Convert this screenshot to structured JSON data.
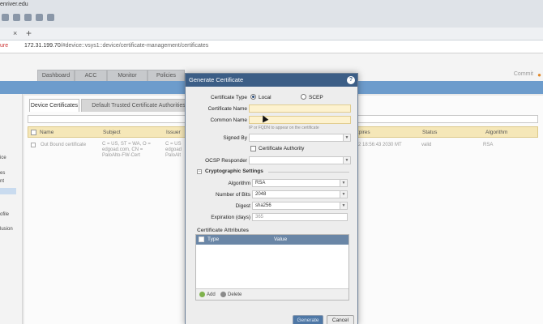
{
  "browser": {
    "window_title": "enriver.edu",
    "tab_close": "×",
    "tab_new": "+",
    "url_warning": "ure",
    "url_host": "172.31.199.70",
    "url_path": "/#device::vsys1::device/certificate-management/certificates"
  },
  "app_nav": {
    "tabs": [
      "Dashboard",
      "ACC",
      "Monitor",
      "Policies"
    ],
    "commit_label": "Commit",
    "accent": "#6d9ccc"
  },
  "sidebar": {
    "items": [
      "ice",
      "es",
      "nt",
      "ofile",
      "lusion"
    ]
  },
  "content": {
    "subtabs": [
      "Device Certificates",
      "Default Trusted Certificate Authorities"
    ],
    "grid_columns": [
      "Name",
      "Subject",
      "Issuer",
      "Expires",
      "Status",
      "Algorithm"
    ],
    "row": {
      "name": "Out Bound certificate",
      "subject": "C = US, ST = WA, O = edgoad.com, CN = PaloAlto-FW-Cert",
      "issuer": "C = US edgoad PaloAlt",
      "expires": "v 12 18:56:43 2030 MT",
      "status": "valid",
      "algorithm": "RSA"
    }
  },
  "dialog": {
    "title": "Generate Certificate",
    "help": "?",
    "certificate_type": {
      "label": "Certificate Type",
      "option_local": "Local",
      "option_scep": "SCEP"
    },
    "certificate_name": {
      "label": "Certificate Name",
      "value": ""
    },
    "common_name": {
      "label": "Common Name",
      "value": "",
      "hint": "IP or FQDN to appear on the certificate"
    },
    "signed_by": {
      "label": "Signed By",
      "value": ""
    },
    "certificate_authority": {
      "label": "Certificate Authority"
    },
    "ocsp_responder": {
      "label": "OCSP Responder",
      "value": ""
    },
    "crypto": {
      "title": "Cryptographic Settings",
      "collapse": "−",
      "algorithm": {
        "label": "Algorithm",
        "value": "RSA"
      },
      "bits": {
        "label": "Number of Bits",
        "value": "2048"
      },
      "digest": {
        "label": "Digest",
        "value": "sha256"
      },
      "expiration": {
        "label": "Expiration (days)",
        "value": "365"
      }
    },
    "attributes": {
      "title": "Certificate Attributes",
      "columns": [
        "Type",
        "Value"
      ],
      "add_label": "Add",
      "delete_label": "Delete"
    },
    "buttons": {
      "generate": "Generate",
      "cancel": "Cancel"
    },
    "colors": {
      "title_bar": "#3c5e86",
      "required_field": "#fdf2cf"
    }
  }
}
